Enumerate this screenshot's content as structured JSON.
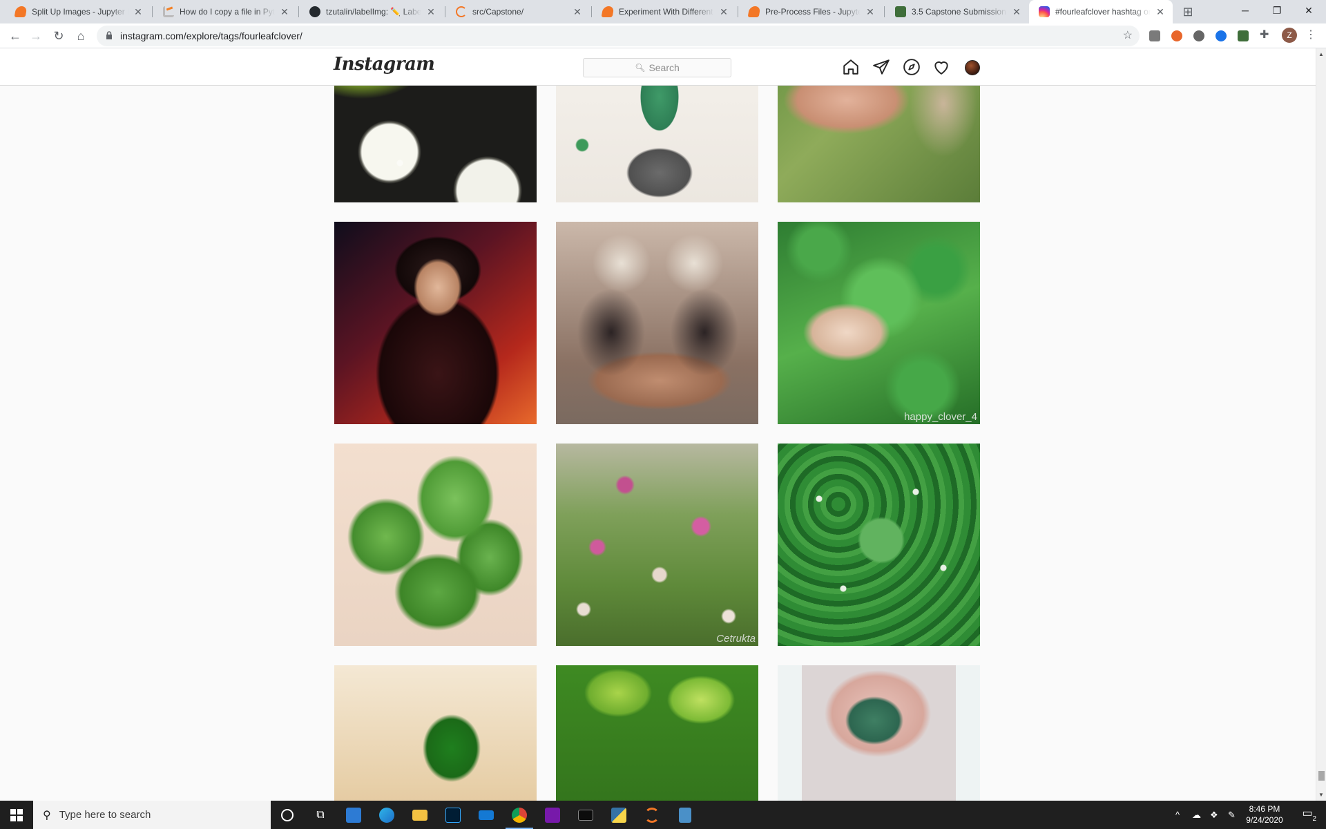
{
  "browser": {
    "tabs": [
      {
        "title": "Split Up Images - Jupyter N",
        "favicon": "jupyter-icon",
        "active": false
      },
      {
        "title": "How do I copy a file in Pyth",
        "favicon": "stackoverflow-icon",
        "active": false
      },
      {
        "title": "tzutalin/labelImg: ✏️ Label",
        "favicon": "github-icon",
        "active": false
      },
      {
        "title": "src/Capstone/",
        "favicon": "loading-icon",
        "active": false
      },
      {
        "title": "Experiment With Different M",
        "favicon": "jupyter-icon",
        "active": false
      },
      {
        "title": "Pre-Process Files - Jupyter N",
        "favicon": "jupyter-icon",
        "active": false
      },
      {
        "title": "3.5 Capstone Submission - L",
        "favicon": "capstone-icon",
        "active": false
      },
      {
        "title": "#fourleafclover hashtag on",
        "favicon": "instagram-icon",
        "active": true
      }
    ],
    "url": "instagram.com/explore/tags/fourleafclover/",
    "profile_initial": "Z"
  },
  "instagram": {
    "logo": "Instagram",
    "search_placeholder": "Search",
    "posts": [
      {
        "desc": "resin coasters with pressed flowers",
        "watermark": ""
      },
      {
        "desc": "drawing of girl in green outfit",
        "watermark": ""
      },
      {
        "desc": "hand holding four leaf clover",
        "watermark": ""
      },
      {
        "desc": "anime character with dark hair",
        "watermark": ""
      },
      {
        "desc": "mirrored photo of person sitting",
        "watermark": ""
      },
      {
        "desc": "hand holding clover in grass",
        "watermark": "happy_clover_4"
      },
      {
        "desc": "close-up of four leaf clover",
        "watermark": ""
      },
      {
        "desc": "field of pink and white clover flowers",
        "watermark": "Cetrukta"
      },
      {
        "desc": "patch of white clover",
        "watermark": ""
      },
      {
        "desc": "clover on light background",
        "watermark": ""
      },
      {
        "desc": "clover leaves in sunlight",
        "watermark": ""
      },
      {
        "desc": "hand holding clover",
        "watermark": ""
      }
    ]
  },
  "taskbar": {
    "search_placeholder": "Type here to search",
    "time": "8:46 PM",
    "date": "9/24/2020",
    "notification_count": "2"
  },
  "colors": {
    "accent": "#7ab3f2",
    "instagram_border": "#dbdbdb",
    "chrome_tabstrip": "#dee1e6"
  }
}
